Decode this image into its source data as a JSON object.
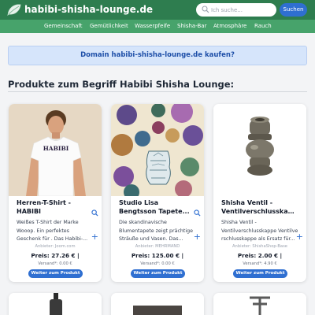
{
  "header": {
    "site_title": "habibi-shisha-lounge.de",
    "search_placeholder": "Ich suche...",
    "search_button": "Suchen",
    "logo_icon": "leaf-icon"
  },
  "nav": {
    "items": [
      "Gemeinschaft",
      "Gemütlichkeit",
      "Wasserpfeife",
      "Shisha-Bar",
      "Atmosphäre",
      "Rauch"
    ]
  },
  "banner": {
    "text": "Domain habibi-shisha-lounge.de kaufen?"
  },
  "section": {
    "title": "Produkte zum Begriff Habibi Shisha Lounge:"
  },
  "products": [
    {
      "title_line1": "Herren-T-Shirt -",
      "title_line2": "HABIBI",
      "desc_lines": [
        "Weißes T-Shirt der Marke",
        "Wooop. Ein perfektes",
        "Geschenk für . Das Habibi-..."
      ],
      "provider": "Anbieter: Joom.com",
      "price": "Preis: 27.26 € |",
      "shipping": "Versand*: 0.00 €",
      "button": "Weiter zum Produkt",
      "shirt_print": "HABIBI"
    },
    {
      "title_line1": "Studio Lisa",
      "title_line2": "Bengtsson Tapete...",
      "desc_lines": [
        "Die skandinavische",
        "Blumentapete zeigt prächtige",
        "Sträuße und Vasen. Das..."
      ],
      "provider": "Anbieter: MEHRMAND",
      "price": "Preis: 125.00 € |",
      "shipping": "Versand*: 0.00 €",
      "button": "Weiter zum Produkt"
    },
    {
      "title_line1": "Shisha Ventil -",
      "title_line2": "Ventilverschlusskappe",
      "desc_lines": [
        "Shisha Ventil -",
        "Ventilverschlusskappe Ventilve",
        "rschlusskappe als Ersatz für..."
      ],
      "provider": "Anbieter: ShishaShop-Base",
      "price": "Preis: 2.00 € |",
      "shipping": "Versand*: 4.90 €",
      "button": "Weiter zum Produkt"
    }
  ],
  "colors": {
    "header_bg": "#2e7d4f",
    "nav_bg": "#47a36b",
    "accent_blue": "#2f6fd1",
    "banner_bg": "#d6e5fb"
  }
}
